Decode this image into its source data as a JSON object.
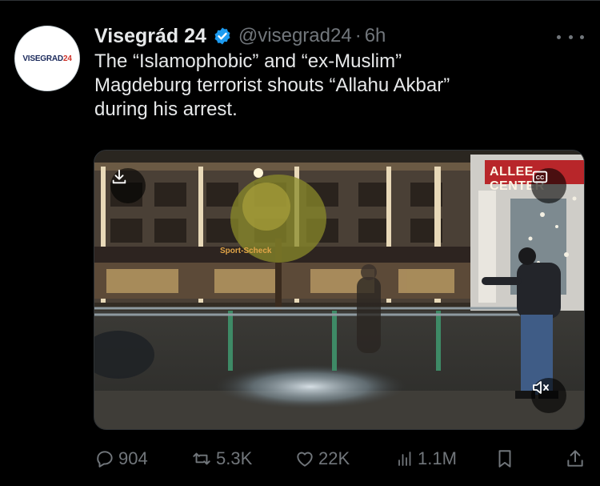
{
  "account": {
    "name": "Visegrád 24",
    "handle": "@visegrad24",
    "separator": "·",
    "time": "6h",
    "avatar_text_main": "VISEGRAD",
    "avatar_text_accent": "24"
  },
  "tweet": {
    "lines": [
      "The “Islamophobic” and “ex-Muslim”",
      "Magdeburg terrorist shouts “Allahu Akbar”",
      "during his arrest."
    ]
  },
  "media": {
    "type": "video",
    "sign_left": "Sport-Scheck",
    "sign_right": "ALLEE CENTER",
    "buttons": {
      "download": "download-icon",
      "captions": "cc-icon",
      "mute": "mute-icon"
    }
  },
  "actions": {
    "replies": "904",
    "reposts": "5.3K",
    "likes": "22K",
    "views": "1.1M"
  },
  "colors": {
    "background": "#000000",
    "text": "#e7e9ea",
    "muted": "#71767b",
    "verified": "#1d9bf0"
  }
}
